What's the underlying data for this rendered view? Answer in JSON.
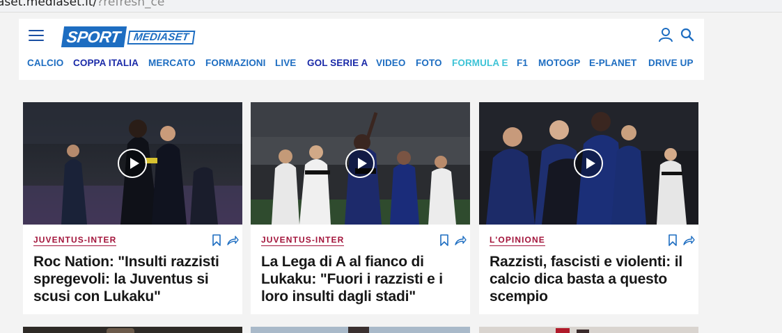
{
  "browser": {
    "url_main": "aset.mediaset.it/",
    "url_rest": "?refresh_ce"
  },
  "header": {
    "logo_sport": "SPORT",
    "logo_mediaset": "MEDIASET",
    "menu_icon": "hamburger-menu-icon",
    "user_icon": "user-icon",
    "search_icon": "search-icon"
  },
  "nav": {
    "items": [
      {
        "label": "CALCIO",
        "color": "#1d6dc1"
      },
      {
        "label": "COPPA ITALIA",
        "color": "#1a2aa8"
      },
      {
        "label": "MERCATO",
        "color": "#1d6dc1"
      },
      {
        "label": "FORMAZIONI",
        "color": "#1d6dc1"
      },
      {
        "label": "LIVE",
        "color": "#1d6dc1"
      },
      {
        "label": "GOL SERIE A",
        "color": "#1a2aa8"
      },
      {
        "label": "VIDEO",
        "color": "#1d6dc1"
      },
      {
        "label": "FOTO",
        "color": "#1d6dc1"
      },
      {
        "label": "FORMULA E",
        "color": "#3dc3d6"
      },
      {
        "label": "F1",
        "color": "#1d6dc1"
      },
      {
        "label": "MOTOGP",
        "color": "#1d6dc1"
      },
      {
        "label": "E-PLANET",
        "color": "#1d6dc1"
      },
      {
        "label": "DRIVE UP",
        "color": "#1d6dc1"
      }
    ]
  },
  "colors": {
    "brand_blue": "#1d6dc1",
    "tag_red": "#a2133a",
    "headline": "#171717"
  },
  "cards": [
    {
      "tag": "JUVENTUS-INTER",
      "headline": "Roc Nation: \"Insulti razzisti spregevoli: la Juventus si scusi con Lukaku\"",
      "has_video": true
    },
    {
      "tag": "JUVENTUS-INTER",
      "headline": "La Lega di A al fianco di Lukaku: \"Fuori i razzisti e i loro insulti dagli stadi\"",
      "has_video": true
    },
    {
      "tag": "L'OPINIONE",
      "headline": "Razzisti, fascisti e violenti: il calcio dica basta a questo scempio",
      "has_video": true
    }
  ]
}
